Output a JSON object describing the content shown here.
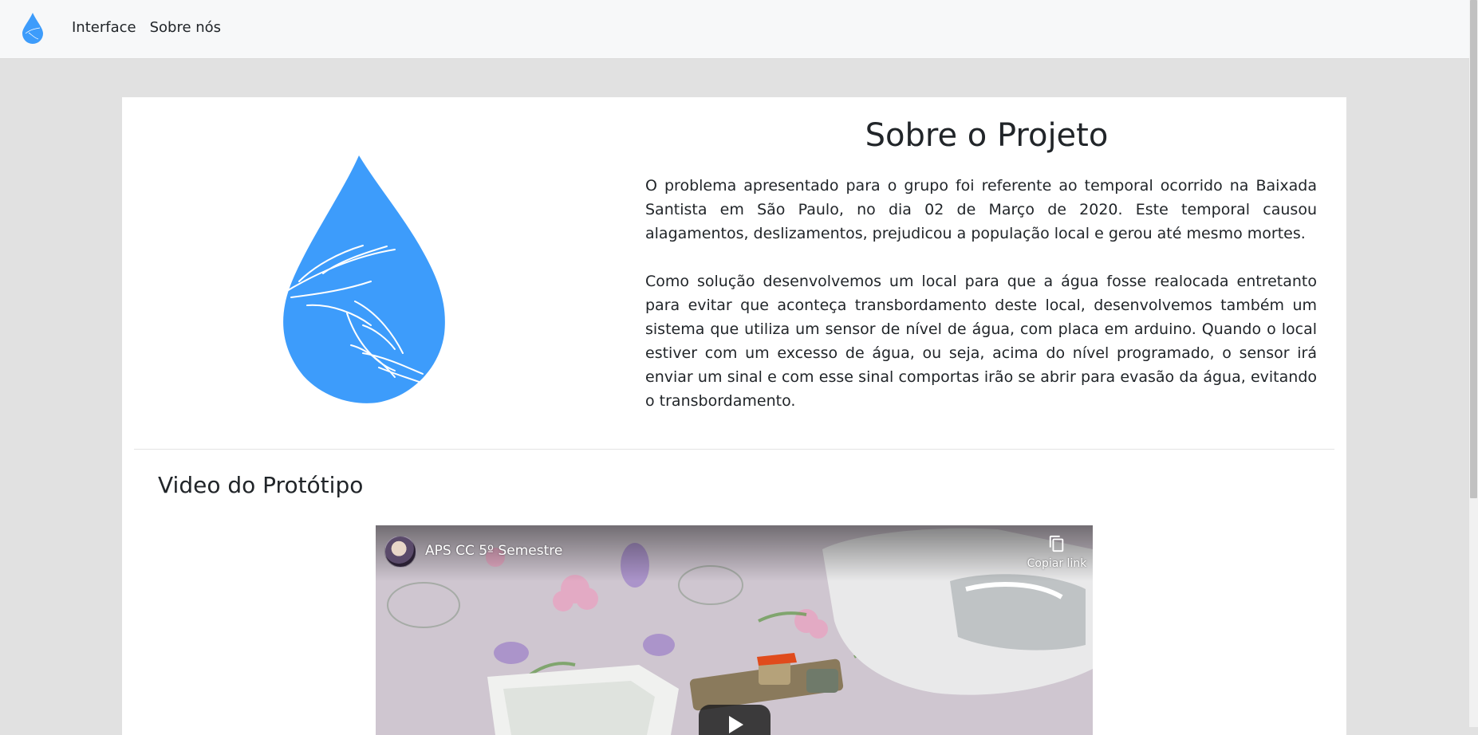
{
  "nav": {
    "links": [
      "Interface",
      "Sobre nós"
    ]
  },
  "about": {
    "title": "Sobre o Projeto",
    "paragraphs": [
      "O problema apresentado para o grupo foi referente ao temporal ocorrido na Baixada Santista em São Paulo, no dia 02 de Março de 2020. Este temporal causou alagamentos, deslizamentos, prejudicou a população local e gerou até mesmo mortes.",
      "Como solução desenvolvemos um local para que a água fosse realocada entretanto para evitar que aconteça transbordamento deste local, desenvolvemos também um sistema que utiliza um sensor de nível de água, com placa em arduino. Quando o local estiver com um excesso de água, ou seja, acima do nível programado, o sensor irá enviar um sinal e com esse sinal comportas irão se abrir para evasão da água, evitando o transbordamento."
    ]
  },
  "video_section": {
    "title": "Video do Protótipo",
    "video_title": "APS CC 5º Semestre",
    "copy_label": "Copiar link"
  },
  "colors": {
    "brand": "#3d9cfb",
    "page_background": "#e1e1e1",
    "navbar_background": "#f7f8f9"
  },
  "icons": [
    "water-drop-logo-icon",
    "copy-icon",
    "play-icon"
  ]
}
